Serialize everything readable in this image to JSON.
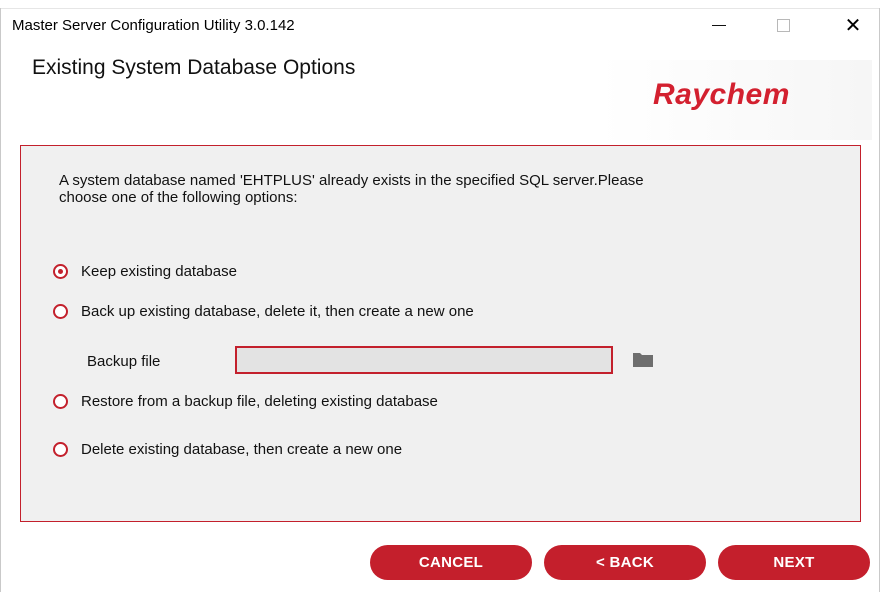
{
  "window": {
    "title": "Master Server Configuration Utility 3.0.142",
    "controls": {
      "minimize_icon": "minimize-icon",
      "maximize_icon": "maximize-icon",
      "close_glyph": "✕"
    }
  },
  "header": {
    "title": "Existing System Database Options",
    "logo_text": "Raychem"
  },
  "panel": {
    "intro": "A system database named 'EHTPLUS' already exists in the specified SQL server.Please choose one of the following options:",
    "options": [
      {
        "label": "Keep existing database",
        "checked": true
      },
      {
        "label": "Back up existing database, delete it, then create a new one",
        "checked": false
      },
      {
        "label": "Restore from a backup file, deleting existing database",
        "checked": false
      },
      {
        "label": "Delete existing database, then create a new one",
        "checked": false
      }
    ],
    "backup_file": {
      "label": "Backup file",
      "value": "",
      "browse_icon": "folder-icon"
    }
  },
  "buttons": {
    "cancel": "CANCEL",
    "back": "< BACK",
    "next": "NEXT"
  },
  "colors": {
    "accent": "#c41f2c",
    "panel_bg": "#f0f0f0"
  }
}
